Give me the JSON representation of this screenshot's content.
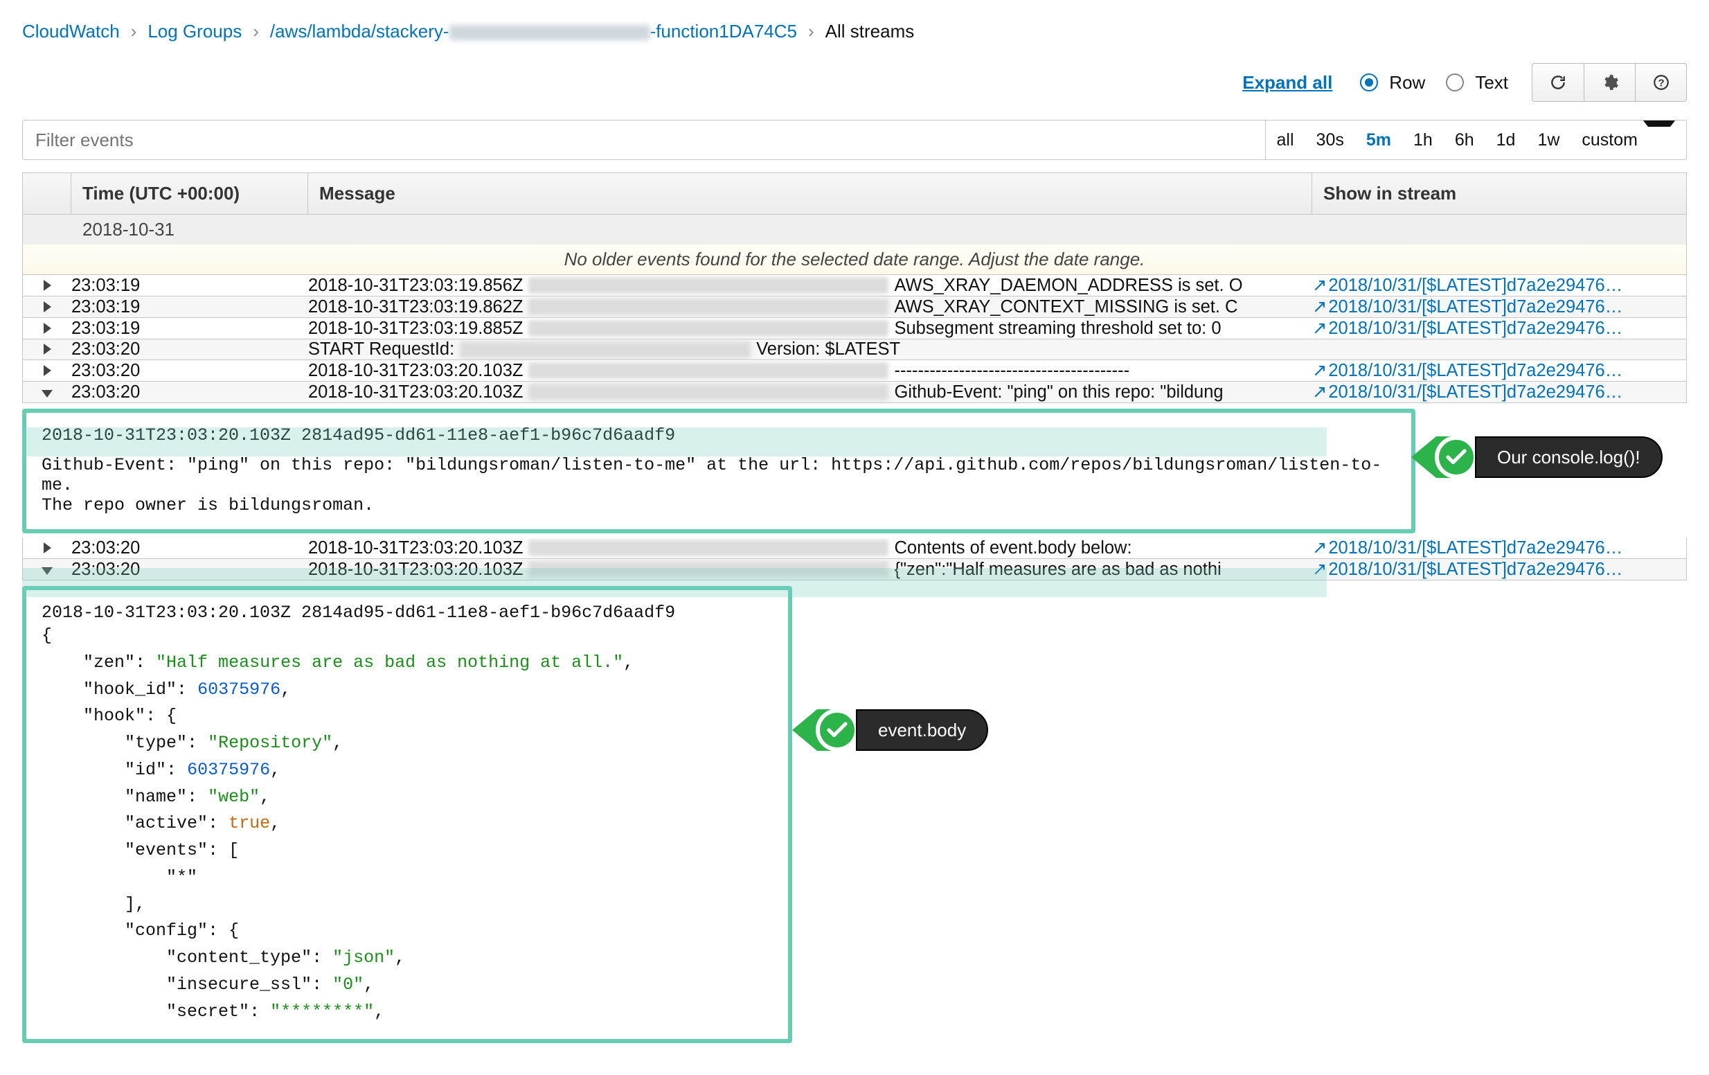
{
  "breadcrumb": {
    "cloudwatch": "CloudWatch",
    "loggroups": "Log Groups",
    "lambda_prefix": "/aws/lambda/stackery-",
    "lambda_suffix": "-function1DA74C5",
    "current": "All streams"
  },
  "toolbar": {
    "expand": "Expand all",
    "row": "Row",
    "text": "Text"
  },
  "filter": {
    "placeholder": "Filter events",
    "ranges": [
      "all",
      "30s",
      "5m",
      "1h",
      "6h",
      "1d",
      "1w",
      "custom"
    ],
    "active": "5m"
  },
  "columns": {
    "time": "Time (UTC +00:00)",
    "message": "Message",
    "stream": "Show in stream"
  },
  "date_label": "2018-10-31",
  "info_stripe": "No older events found for the selected date range. Adjust the date range.",
  "stream_link": "2018/10/31/[$LATEST]d7a2e29476…",
  "rows": [
    {
      "expand": "right",
      "time": "23:03:19",
      "ts": "2018-10-31T23:03:19.856Z",
      "blur": true,
      "tail": "AWS_XRAY_DAEMON_ADDRESS is set. O",
      "link": true
    },
    {
      "expand": "right",
      "time": "23:03:19",
      "ts": "2018-10-31T23:03:19.862Z",
      "blur": true,
      "tail": "AWS_XRAY_CONTEXT_MISSING is set. C",
      "link": true
    },
    {
      "expand": "right",
      "time": "23:03:19",
      "ts": "2018-10-31T23:03:19.885Z",
      "blur": true,
      "tail": "Subsegment streaming threshold set to: 0",
      "link": true
    },
    {
      "expand": "right",
      "time": "23:03:20",
      "ts": "START RequestId:",
      "blur": true,
      "blurw": 420,
      "tail": "Version: $LATEST",
      "link": false
    },
    {
      "expand": "right",
      "time": "23:03:20",
      "ts": "2018-10-31T23:03:20.103Z",
      "blur": true,
      "tail": "----------------------------------------",
      "link": true
    },
    {
      "expand": "down",
      "time": "23:03:20",
      "ts": "2018-10-31T23:03:20.103Z",
      "blur": true,
      "tail": "Github-Event: \"ping\" on this repo: \"bildung",
      "link": true
    }
  ],
  "detail1": {
    "line1": "2018-10-31T23:03:20.103Z 2814ad95-dd61-11e8-aef1-b96c7d6aadf9",
    "line2": "Github-Event: \"ping\" on this repo: \"bildungsroman/listen-to-me\" at the url: https://api.github.com/repos/bildungsroman/listen-to-me.",
    "line3": "The repo owner is bildungsroman.",
    "callout": "Our console.log()!"
  },
  "rows2": [
    {
      "expand": "right",
      "time": "23:03:20",
      "ts": "2018-10-31T23:03:20.103Z",
      "blur": true,
      "tail": "Contents of event.body below:",
      "link": true
    },
    {
      "expand": "down",
      "time": "23:03:20",
      "ts": "2018-10-31T23:03:20.103Z",
      "blur": true,
      "tail": "{\"zen\":\"Half measures are as bad as nothi",
      "link": true
    }
  ],
  "detail2": {
    "header": "2018-10-31T23:03:20.103Z 2814ad95-dd61-11e8-aef1-b96c7d6aadf9",
    "json_plain": "{\n    \"zen\": \"Half measures are as bad as nothing at all.\",\n    \"hook_id\": 60375976,\n    \"hook\": {\n        \"type\": \"Repository\",\n        \"id\": 60375976,\n        \"name\": \"web\",\n        \"active\": true,\n        \"events\": [\n            \"*\"\n        ],\n        \"config\": {\n            \"content_type\": \"json\",\n            \"insecure_ssl\": \"0\",\n            \"secret\": \"********\",",
    "json_data": {
      "zen": "Half measures are as bad as nothing at all.",
      "hook_id": 60375976,
      "hook": {
        "type": "Repository",
        "id": 60375976,
        "name": "web",
        "active": true,
        "events": [
          "*"
        ],
        "config": {
          "content_type": "json",
          "insecure_ssl": "0",
          "secret": "********"
        }
      }
    },
    "callout": "event.body"
  }
}
